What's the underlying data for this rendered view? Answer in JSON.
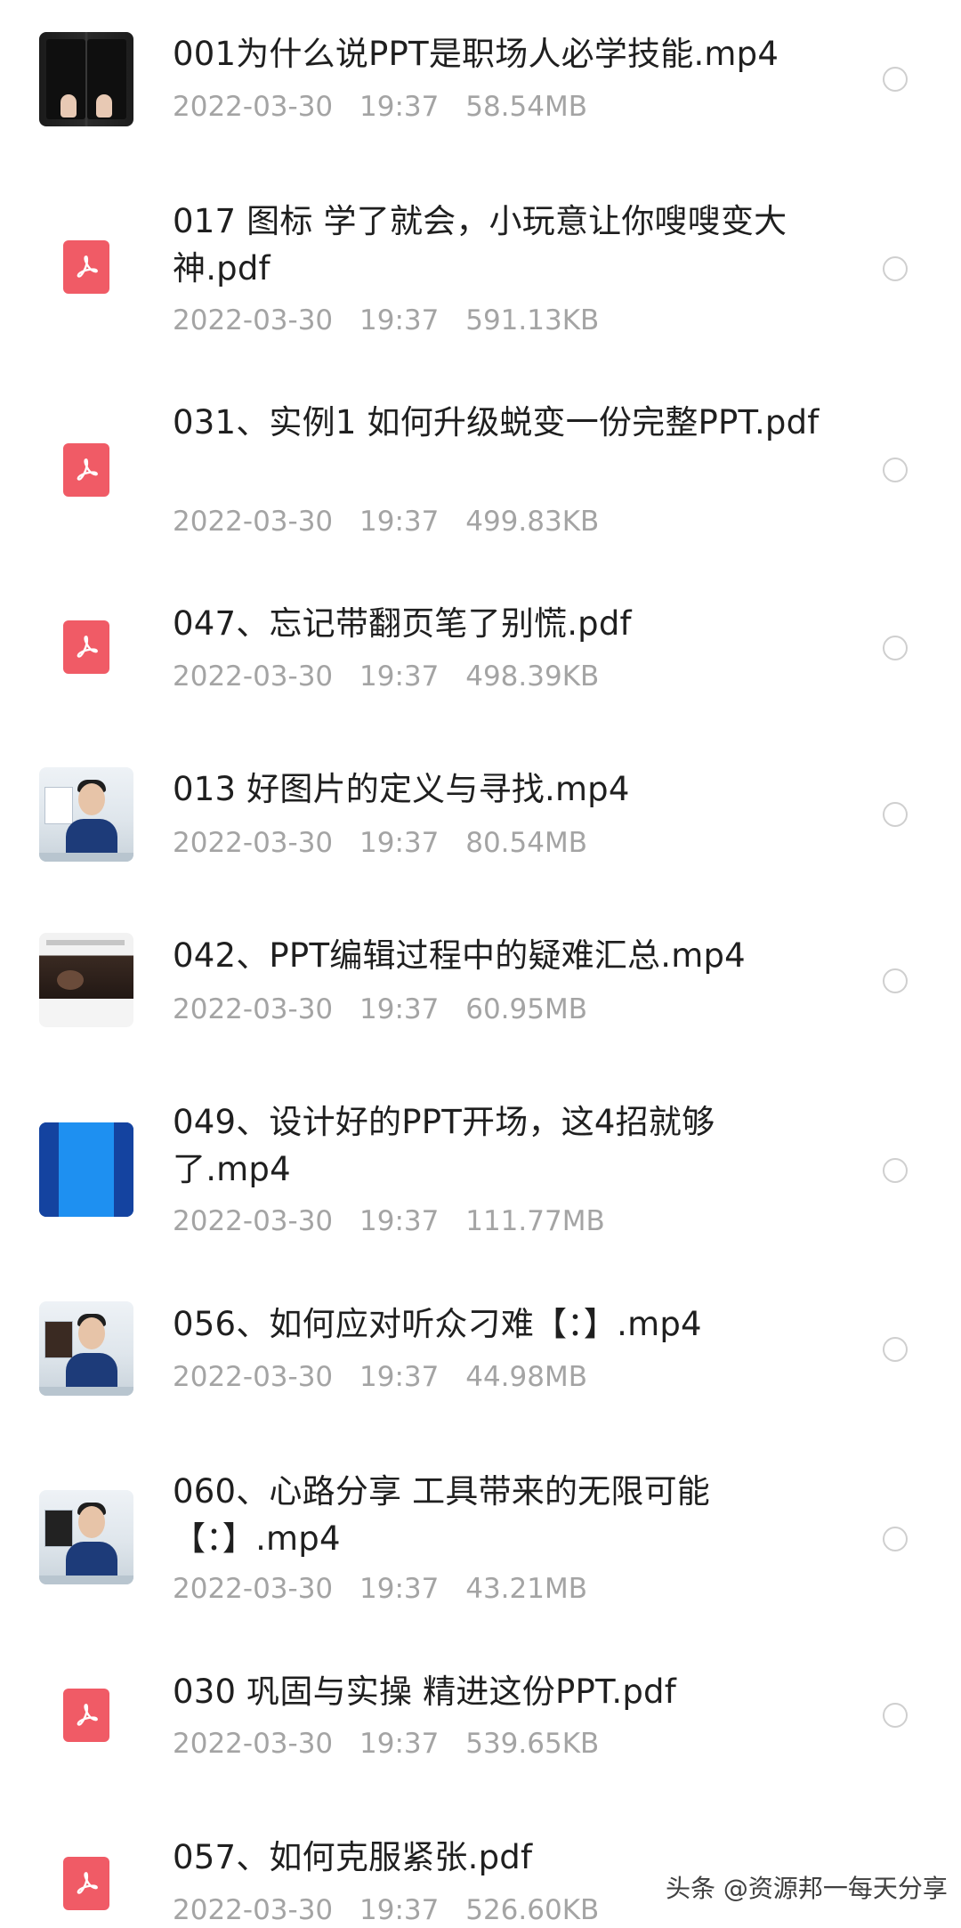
{
  "files": [
    {
      "name": "001为什么说PPT是职场人必学技能.mp4",
      "date": "2022-03-30",
      "time": "19:37",
      "size": "58.54MB",
      "icon": "video-thumbnail-icon"
    },
    {
      "name": "017 图标 学了就会，小玩意让你嗖嗖变大神.pdf",
      "date": "2022-03-30",
      "time": "19:37",
      "size": "591.13KB",
      "icon": "pdf-icon"
    },
    {
      "name": "031、实例1 如何升级蜕变一份完整PPT.pdf",
      "date": "2022-03-30",
      "time": "19:37",
      "size": "499.83KB",
      "icon": "pdf-icon"
    },
    {
      "name": "047、忘记带翻页笔了别慌.pdf",
      "date": "2022-03-30",
      "time": "19:37",
      "size": "498.39KB",
      "icon": "pdf-icon"
    },
    {
      "name": "013 好图片的定义与寻找.mp4",
      "date": "2022-03-30",
      "time": "19:37",
      "size": "80.54MB",
      "icon": "video-thumbnail-icon"
    },
    {
      "name": "042、PPT编辑过程中的疑难汇总.mp4",
      "date": "2022-03-30",
      "time": "19:37",
      "size": "60.95MB",
      "icon": "video-thumbnail-icon"
    },
    {
      "name": "049、设计好的PPT开场，这4招就够了.mp4",
      "date": "2022-03-30",
      "time": "19:37",
      "size": "111.77MB",
      "icon": "video-thumbnail-icon"
    },
    {
      "name": "056、如何应对听众刁难【：】.mp4",
      "date": "2022-03-30",
      "time": "19:37",
      "size": "44.98MB",
      "icon": "video-thumbnail-icon"
    },
    {
      "name": "060、心路分享 工具带来的无限可能【：】.mp4",
      "date": "2022-03-30",
      "time": "19:37",
      "size": "43.21MB",
      "icon": "video-thumbnail-icon"
    },
    {
      "name": "030 巩固与实操 精进这份PPT.pdf",
      "date": "2022-03-30",
      "time": "19:37",
      "size": "539.65KB",
      "icon": "pdf-icon"
    },
    {
      "name": "057、如何克服紧张.pdf",
      "date": "2022-03-30",
      "time": "19:37",
      "size": "526.60KB",
      "icon": "pdf-icon"
    }
  ],
  "watermark": "头条 @资源邦一每天分享",
  "colors": {
    "pdf_red": "#f05b66",
    "meta_gray": "#a4a4a4",
    "radio_border": "#cfcfcf"
  }
}
